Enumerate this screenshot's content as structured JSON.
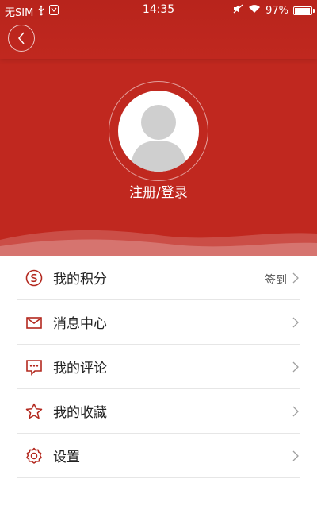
{
  "status_bar": {
    "carrier": "无SIM",
    "time": "14:35",
    "battery_percent": "97%",
    "battery_level": 0.97
  },
  "profile": {
    "login_label": "注册/登录"
  },
  "menu": [
    {
      "label": "我的积分",
      "icon": "points-icon",
      "extra": "签到"
    },
    {
      "label": "消息中心",
      "icon": "mail-icon",
      "extra": ""
    },
    {
      "label": "我的评论",
      "icon": "comment-icon",
      "extra": ""
    },
    {
      "label": "我的收藏",
      "icon": "star-icon",
      "extra": ""
    },
    {
      "label": "设置",
      "icon": "gear-icon",
      "extra": ""
    }
  ],
  "colors": {
    "header_red": "#c0281f",
    "icon_red": "#b3281e"
  }
}
